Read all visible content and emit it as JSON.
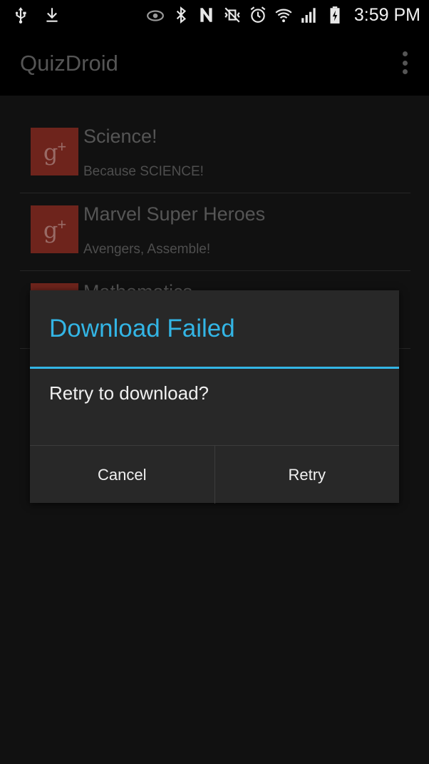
{
  "status_bar": {
    "time": "3:59 PM",
    "icons": [
      "usb-icon",
      "download-icon",
      "eye-icon",
      "bluetooth-icon",
      "nfc-icon",
      "vibrate-mute-icon",
      "alarm-icon",
      "wifi-icon",
      "signal-icon",
      "battery-charging-icon"
    ]
  },
  "action_bar": {
    "title": "QuizDroid",
    "overflow_icon": "overflow-menu-icon"
  },
  "quiz_list": {
    "items": [
      {
        "title": "Science!",
        "subtitle": "Because SCIENCE!",
        "icon": "google-plus-icon"
      },
      {
        "title": "Marvel Super Heroes",
        "subtitle": "Avengers, Assemble!",
        "icon": "google-plus-icon"
      },
      {
        "title": "Mathematics",
        "subtitle": "",
        "icon": "google-plus-icon"
      }
    ]
  },
  "dialog": {
    "title": "Download Failed",
    "message": "Retry to download?",
    "cancel_label": "Cancel",
    "retry_label": "Retry"
  },
  "colors": {
    "accent": "#33b5e5",
    "background": "#111111",
    "dialog_background": "#282828",
    "thumb_background": "#6e241c"
  }
}
